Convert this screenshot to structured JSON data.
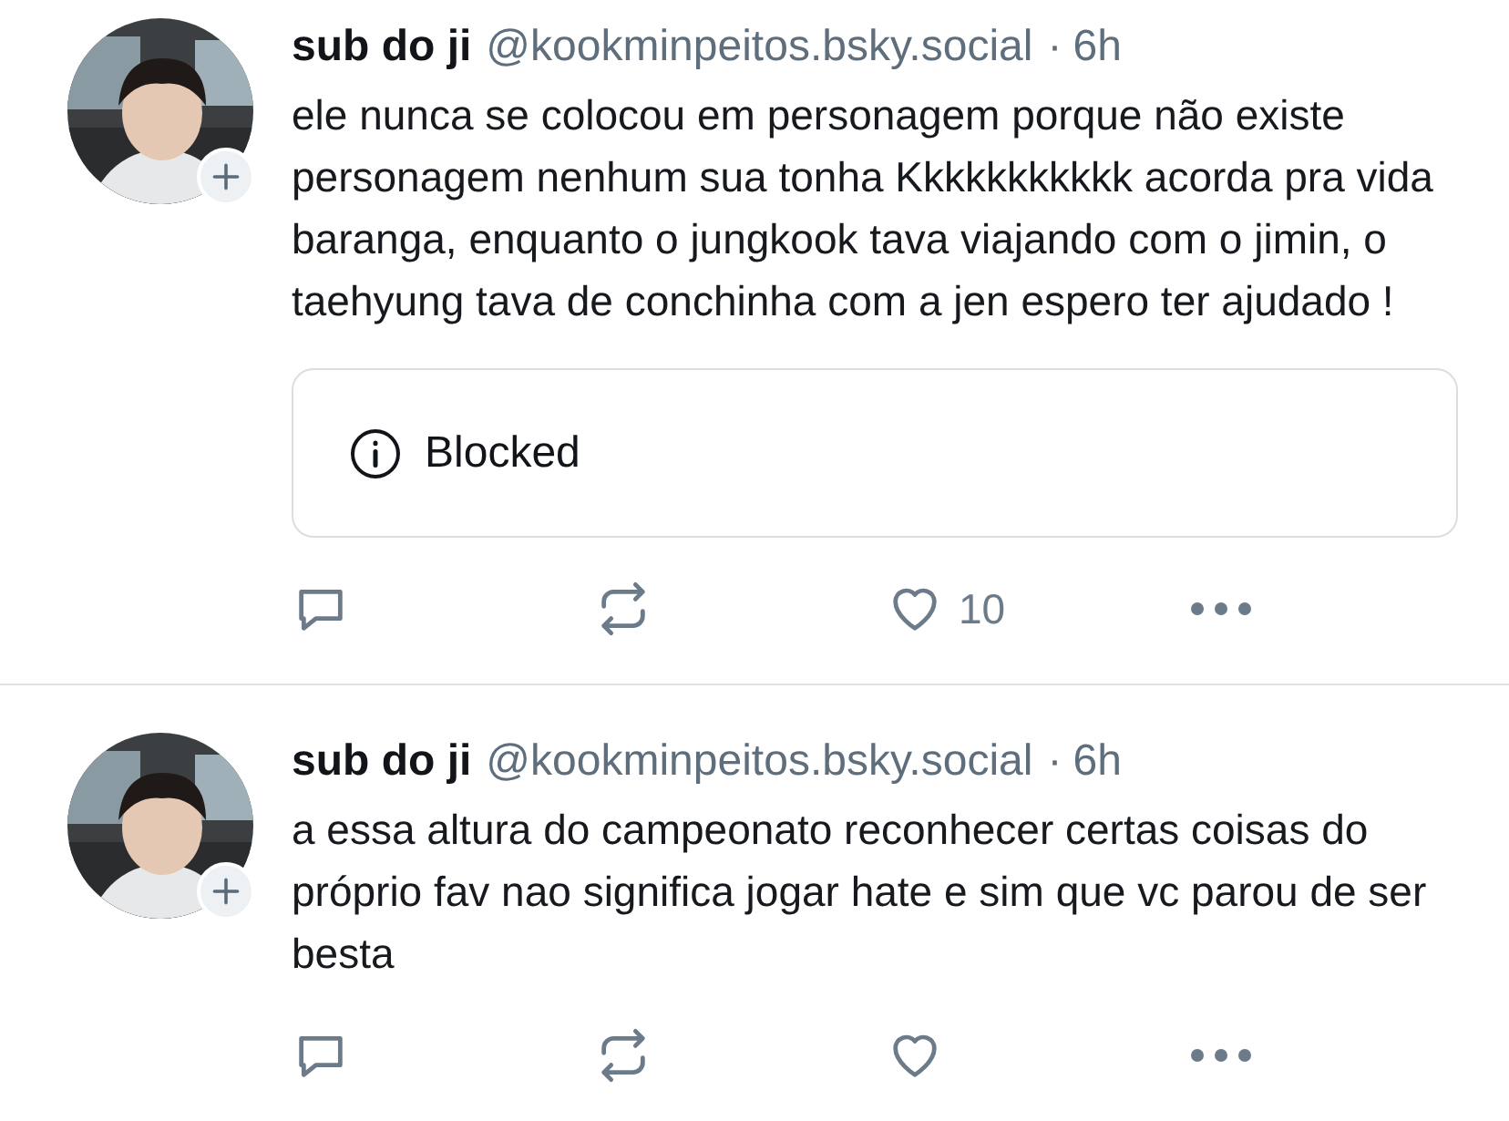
{
  "posts": [
    {
      "author": "sub do ji",
      "handle": "@kookminpeitos.bsky.social",
      "separator": "·",
      "time": "6h",
      "text": "ele nunca se colocou em personagem porque não existe personagem nenhum sua tonha Kkkkkkkkkkk acorda pra vida baranga, enquanto o jungkook tava viajando com o jimin, o taehyung tava de conchinha com a jen espero ter ajudado !",
      "embed": {
        "label": "Blocked"
      },
      "like_count": "10"
    },
    {
      "author": "sub do ji",
      "handle": "@kookminpeitos.bsky.social",
      "separator": "·",
      "time": "6h",
      "text": "a essa altura do campeonato reconhecer certas coisas do próprio fav nao significa jogar hate e sim que vc parou de ser besta"
    }
  ]
}
